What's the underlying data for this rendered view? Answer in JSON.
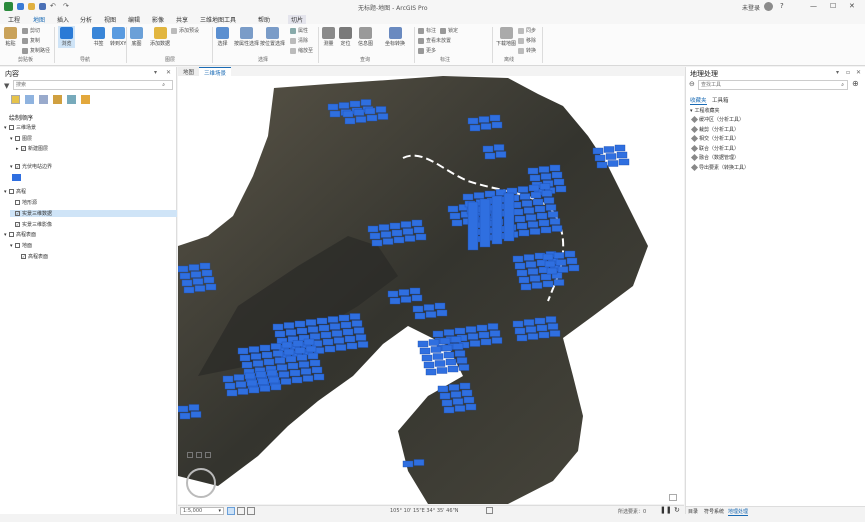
{
  "app": {
    "title": "无标题-地图 - ArcGIS Pro",
    "user": "未登录",
    "win_min": "—",
    "win_max": "☐",
    "win_close": "✕",
    "help": "?"
  },
  "menu": {
    "items": [
      "工程",
      "地图",
      "插入",
      "分析",
      "视图",
      "编辑",
      "影像",
      "共享",
      "三维地图工具",
      "帮助"
    ],
    "context_tab": "切片"
  },
  "ribbon": {
    "clipboard": {
      "paste": "粘贴",
      "cut": "剪切",
      "copy": "复制",
      "copy_path": "复制路径",
      "group": "剪贴板"
    },
    "navigate": {
      "explore": "浏览",
      "bookmarks": "书签",
      "go_to_xy": "转到XY",
      "group": "导航"
    },
    "layer": {
      "basemap": "底图",
      "add_data": "添加数据",
      "add_preset": "添加预设",
      "group": "图层"
    },
    "selection": {
      "select": "选择",
      "by_attribute": "按属性选择",
      "by_location": "按位置选择",
      "attributes": "属性",
      "clear": "清除",
      "zoom_to": "缩放至",
      "group": "选择"
    },
    "inquiry": {
      "measure": "测量",
      "locate": "定位",
      "infographics": "信息图",
      "coordinate_conversion": "坐标转换",
      "group": "查询"
    },
    "labeling": {
      "label": "标注",
      "lock": "锁定",
      "view_unplaced": "查看未放置",
      "more": "更多",
      "group": "标注"
    },
    "offline": {
      "download_map": "下载地图",
      "sync": "同步",
      "remove": "移除",
      "convert": "转换",
      "group": "离线"
    }
  },
  "contents": {
    "title": "内容",
    "search_placeholder": "搜索",
    "drawing_order": "绘制顺序",
    "tree": [
      {
        "label": "三维场景",
        "indent": 0,
        "check": false,
        "expander": "▾"
      },
      {
        "label": "图层",
        "indent": 1,
        "check": false,
        "expander": "▾"
      },
      {
        "label": "新建图层",
        "indent": 2,
        "check": true,
        "expander": "▸"
      },
      {
        "label": "光伏电站边界",
        "indent": 1,
        "check": true,
        "expander": "▾"
      },
      {
        "label": "高程",
        "indent": 0,
        "check": false,
        "expander": "▾"
      },
      {
        "label": "地形源",
        "indent": 1,
        "check": false,
        "expander": ""
      },
      {
        "label": "实景三维数据",
        "indent": 1,
        "check": true,
        "expander": "",
        "selected": true
      },
      {
        "label": "实景三维影像",
        "indent": 1,
        "check": true,
        "expander": ""
      },
      {
        "label": "高程表面",
        "indent": 0,
        "check": false,
        "expander": "▾"
      },
      {
        "label": "地面",
        "indent": 1,
        "check": false,
        "expander": "▾"
      },
      {
        "label": "高程表面",
        "indent": 2,
        "check": true,
        "expander": ""
      }
    ]
  },
  "view": {
    "tabs": [
      "地图",
      "三维场景"
    ],
    "active_tab": 1,
    "scale": "1:5,000",
    "coords": "105° 10' 15\"E  34° 35' 46\"N",
    "selected_features": "所选要素：0"
  },
  "geoprocessing": {
    "title": "地理处理",
    "search_placeholder": "查找工具",
    "tab_favorites": "收藏夹",
    "tab_toolboxes": "工具箱",
    "folder": "工程收藏夹",
    "tools": [
      "缓冲区（分析工具）",
      "裁剪（分析工具）",
      "相交（分析工具）",
      "联合（分析工具）",
      "融合（数据管理）",
      "导出要素（转换工具）"
    ],
    "bottom_tabs": [
      "目录",
      "符号系统",
      "地理处理"
    ]
  },
  "colors": {
    "accent": "#1a6bb5",
    "solar_panel": "#2f6fe0",
    "terrain_dark": "#3a3a34"
  }
}
